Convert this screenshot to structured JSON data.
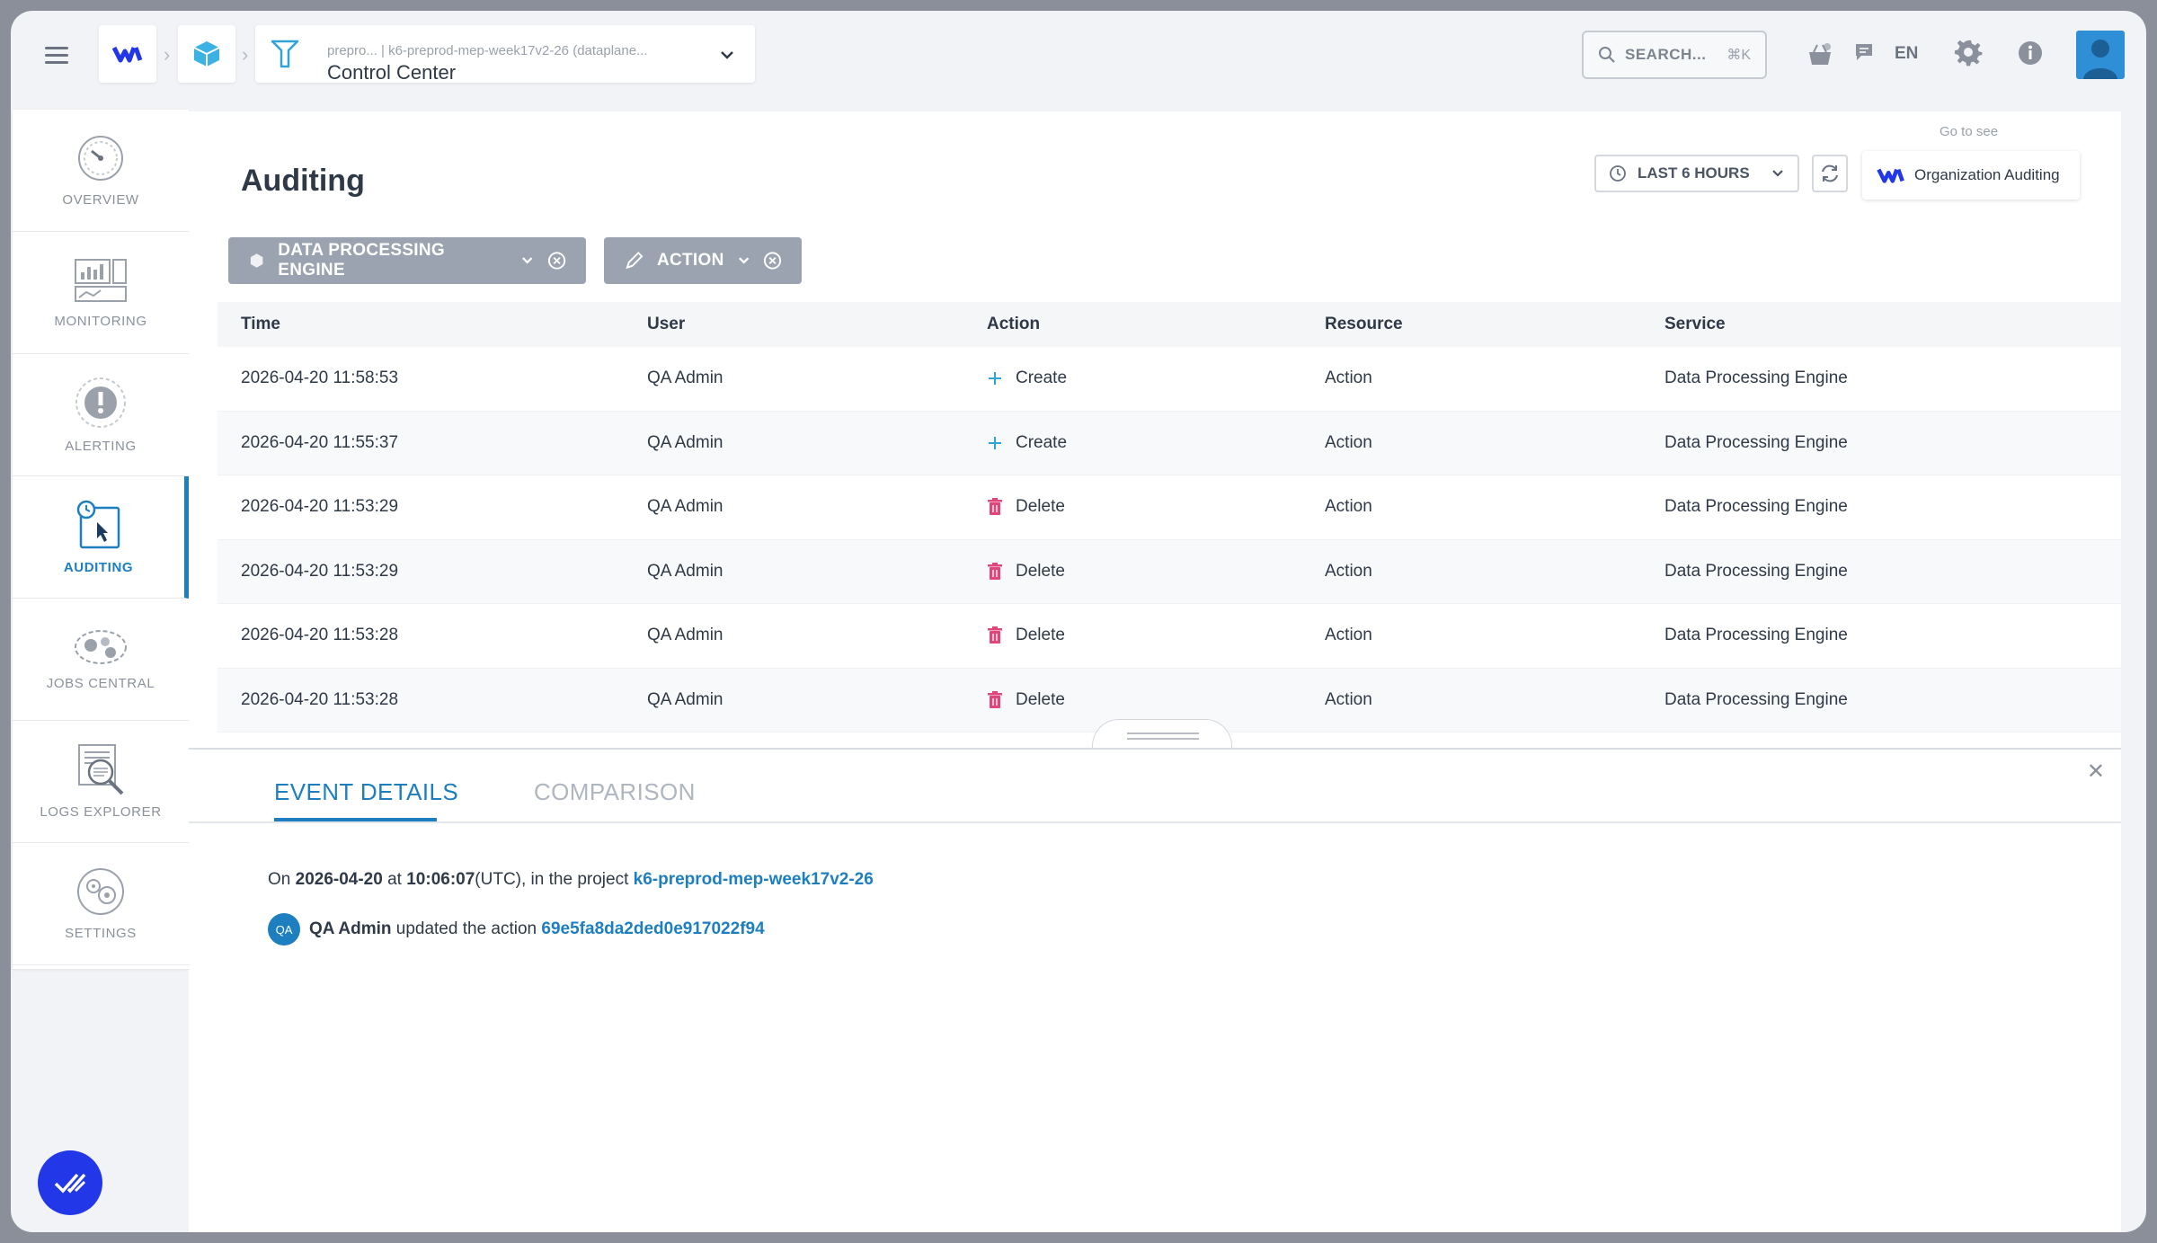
{
  "topbar": {
    "breadcrumb_sub": "prepro...    | k6-preprod-mep-week17v2-26 (dataplane...",
    "breadcrumb_main": "Control Center",
    "search_placeholder": "SEARCH...",
    "search_shortcut": "⌘K",
    "language": "EN"
  },
  "sidebar": {
    "items": [
      {
        "label": "OVERVIEW",
        "icon": "gauge-icon"
      },
      {
        "label": "MONITORING",
        "icon": "monitoring-icon"
      },
      {
        "label": "ALERTING",
        "icon": "alert-icon"
      },
      {
        "label": "AUDITING",
        "icon": "auditing-icon",
        "active": true
      },
      {
        "label": "JOBS CENTRAL",
        "icon": "jobs-icon"
      },
      {
        "label": "LOGS EXPLORER",
        "icon": "logs-icon"
      },
      {
        "label": "SETTINGS",
        "icon": "settings-icon"
      }
    ]
  },
  "page": {
    "title": "Auditing",
    "time_range": "LAST 6 HOURS",
    "goto_label": "Go to see",
    "org_auditing": "Organization Auditing"
  },
  "filters": {
    "service": "DATA PROCESSING ENGINE",
    "action": "ACTION"
  },
  "table": {
    "headers": [
      "Time",
      "User",
      "Action",
      "Resource",
      "Service"
    ],
    "rows": [
      {
        "time": "2026-04-20 11:58:53",
        "user": "QA Admin",
        "action": "Create",
        "action_icon": "plus-icon",
        "resource": "Action",
        "service": "Data Processing Engine"
      },
      {
        "time": "2026-04-20 11:55:37",
        "user": "QA Admin",
        "action": "Create",
        "action_icon": "plus-icon",
        "resource": "Action",
        "service": "Data Processing Engine"
      },
      {
        "time": "2026-04-20 11:53:29",
        "user": "QA Admin",
        "action": "Delete",
        "action_icon": "trash-icon",
        "resource": "Action",
        "service": "Data Processing Engine"
      },
      {
        "time": "2026-04-20 11:53:29",
        "user": "QA Admin",
        "action": "Delete",
        "action_icon": "trash-icon",
        "resource": "Action",
        "service": "Data Processing Engine"
      },
      {
        "time": "2026-04-20 11:53:28",
        "user": "QA Admin",
        "action": "Delete",
        "action_icon": "trash-icon",
        "resource": "Action",
        "service": "Data Processing Engine"
      },
      {
        "time": "2026-04-20 11:53:28",
        "user": "QA Admin",
        "action": "Delete",
        "action_icon": "trash-icon",
        "resource": "Action",
        "service": "Data Processing Engine"
      }
    ]
  },
  "details": {
    "tab_event": "EVENT DETAILS",
    "tab_comparison": "COMPARISON",
    "line1_prefix": "On ",
    "line1_date": "2026-04-20",
    "line1_at": " at ",
    "line1_time": "10:06:07",
    "line1_suffix": "(UTC), in the project ",
    "project": "k6-preprod-mep-week17v2-26",
    "user_initials": "QA",
    "user_name": "QA Admin",
    "action_text": " updated the action ",
    "action_id": "69e5fa8da2ded0e917022f94"
  },
  "colors": {
    "accent": "#1d7fbf",
    "chip": "#9aa3af",
    "delete": "#e0457b",
    "fab": "#2238e8"
  }
}
